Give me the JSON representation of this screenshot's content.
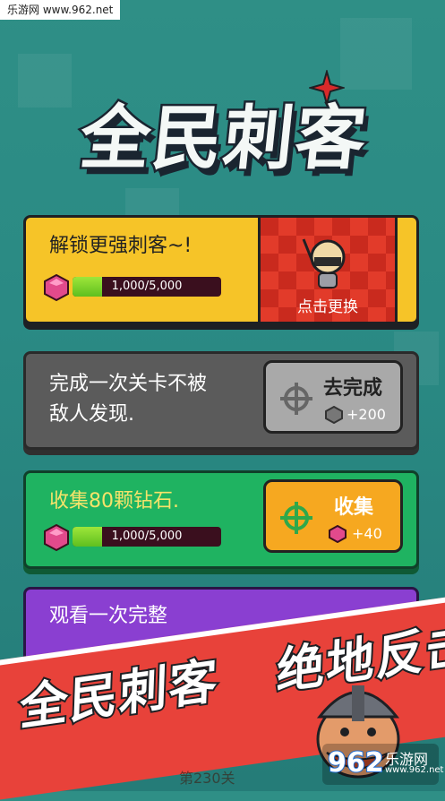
{
  "watermark_top": "乐游网 www.962.net",
  "title": "全民刺客",
  "tasks": [
    {
      "text": "解锁更强刺客~!",
      "progress_text": "1,000/5,000",
      "progress": 0.2,
      "action_label": "点击更换"
    },
    {
      "text_line1": "完成一次关卡不被",
      "text_line2": "敌人发现.",
      "button_label": "去完成",
      "reward": "+200"
    },
    {
      "text": "收集80颗钻石.",
      "progress_text": "1,000/5,000",
      "progress": 0.2,
      "button_label": "收集",
      "reward": "+40"
    },
    {
      "text": "观看一次完整"
    }
  ],
  "banner": {
    "left": "全民刺客",
    "right": "绝地反击"
  },
  "partial_stage_text": "第230关",
  "watermark_bottom": {
    "number": "962",
    "site": "乐游网",
    "url": "www.962.net"
  },
  "colors": {
    "card1": "#f6c428",
    "card2": "#5b5b5b",
    "card3": "#1fb361",
    "card4": "#8a3fd1",
    "banner": "#e8423a"
  }
}
